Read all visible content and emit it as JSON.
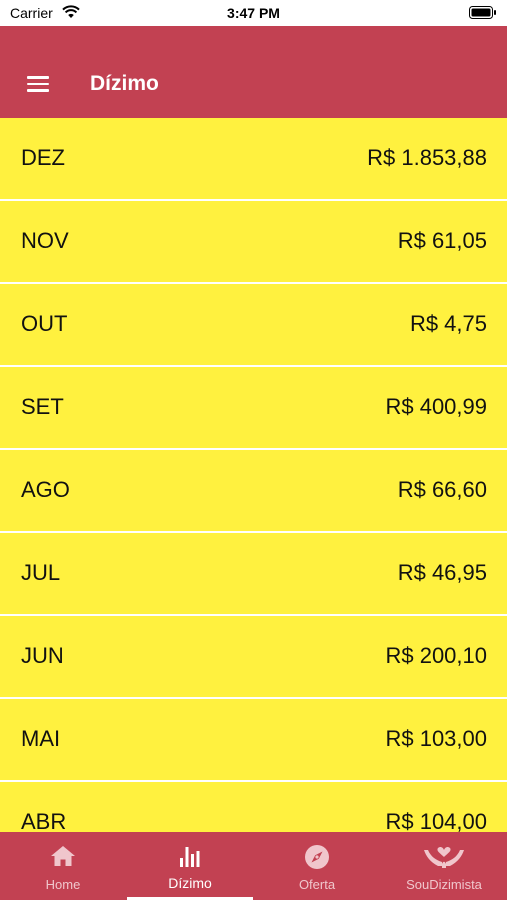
{
  "status_bar": {
    "carrier": "Carrier",
    "time": "3:47 PM"
  },
  "app_bar": {
    "title": "Dízimo"
  },
  "entries": [
    {
      "month": "DEZ",
      "amount": "R$ 1.853,88"
    },
    {
      "month": "NOV",
      "amount": "R$ 61,05"
    },
    {
      "month": "OUT",
      "amount": "R$ 4,75"
    },
    {
      "month": "SET",
      "amount": "R$ 400,99"
    },
    {
      "month": "AGO",
      "amount": "R$ 66,60"
    },
    {
      "month": "JUL",
      "amount": "R$ 46,95"
    },
    {
      "month": "JUN",
      "amount": "R$ 200,10"
    },
    {
      "month": "MAI",
      "amount": "R$ 103,00"
    },
    {
      "month": "ABR",
      "amount": "R$ 104,00"
    }
  ],
  "tabs": [
    {
      "label": "Home",
      "icon": "home-icon"
    },
    {
      "label": "Dízimo",
      "icon": "bar-chart-icon",
      "active": true
    },
    {
      "label": "Oferta",
      "icon": "compass-icon"
    },
    {
      "label": "SouDizimista",
      "icon": "hands-heart-icon"
    }
  ],
  "colors": {
    "primary": "#c24152",
    "row_background": "#fff13f",
    "text": "#111111"
  }
}
